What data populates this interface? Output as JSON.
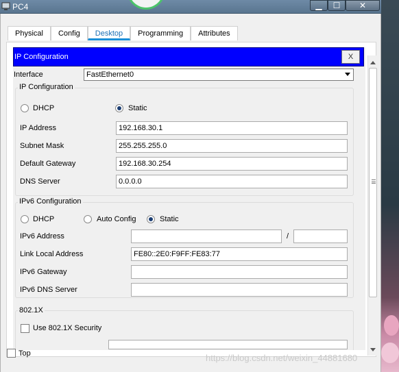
{
  "window": {
    "title": "PC4",
    "minimize": "▁",
    "maximize": "☐",
    "close": "✕"
  },
  "tabs": [
    {
      "label": "Physical"
    },
    {
      "label": "Config"
    },
    {
      "label": "Desktop"
    },
    {
      "label": "Programming"
    },
    {
      "label": "Attributes"
    }
  ],
  "ipconfig": {
    "header": "IP Configuration",
    "close_label": "X",
    "interface_label": "Interface",
    "interface_value": "FastEthernet0",
    "ipv4": {
      "group_title": "IP Configuration",
      "dhcp_label": "DHCP",
      "static_label": "Static",
      "selected": "Static",
      "ip_label": "IP Address",
      "ip_value": "192.168.30.1",
      "mask_label": "Subnet Mask",
      "mask_value": "255.255.255.0",
      "gateway_label": "Default Gateway",
      "gateway_value": "192.168.30.254",
      "dns_label": "DNS Server",
      "dns_value": "0.0.0.0"
    },
    "ipv6": {
      "group_title": "IPv6 Configuration",
      "dhcp_label": "DHCP",
      "auto_label": "Auto Config",
      "static_label": "Static",
      "selected": "Static",
      "address_label": "IPv6 Address",
      "address_value": "",
      "prefix_sep": "/",
      "prefix_value": "",
      "link_local_label": "Link Local Address",
      "link_local_value": "FE80::2E0:F9FF:FE83:77",
      "gateway_label": "IPv6 Gateway",
      "gateway_value": "",
      "dns_label": "IPv6 DNS Server",
      "dns_value": ""
    },
    "dot1x": {
      "group_title": "802.1X",
      "use_label": "Use 802.1X Security"
    }
  },
  "footer": {
    "top_label": "Top",
    "watermark": "https://blog.csdn.net/weixin_44881680"
  }
}
